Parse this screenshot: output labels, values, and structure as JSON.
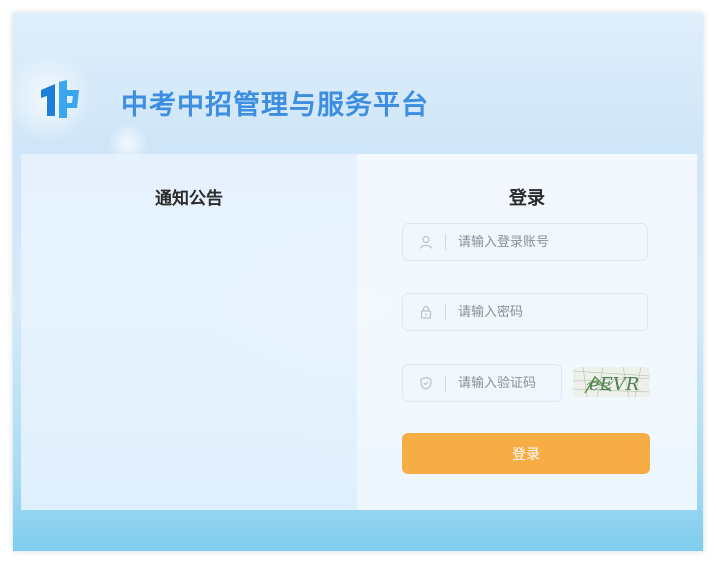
{
  "header": {
    "title": "中考中招管理与服务平台"
  },
  "notice": {
    "title": "通知公告"
  },
  "login": {
    "title": "登录",
    "username_placeholder": "请输入登录账号",
    "password_placeholder": "请输入密码",
    "captcha_placeholder": "请输入验证码",
    "captcha_text": "eEVR",
    "submit_label": "登录"
  },
  "colors": {
    "brand": "#3d8ee0",
    "button": "#f7ad45",
    "captcha_ink": "#4a3a9a"
  },
  "icons": [
    "logo-icon",
    "user-icon",
    "lock-icon",
    "shield-icon"
  ]
}
